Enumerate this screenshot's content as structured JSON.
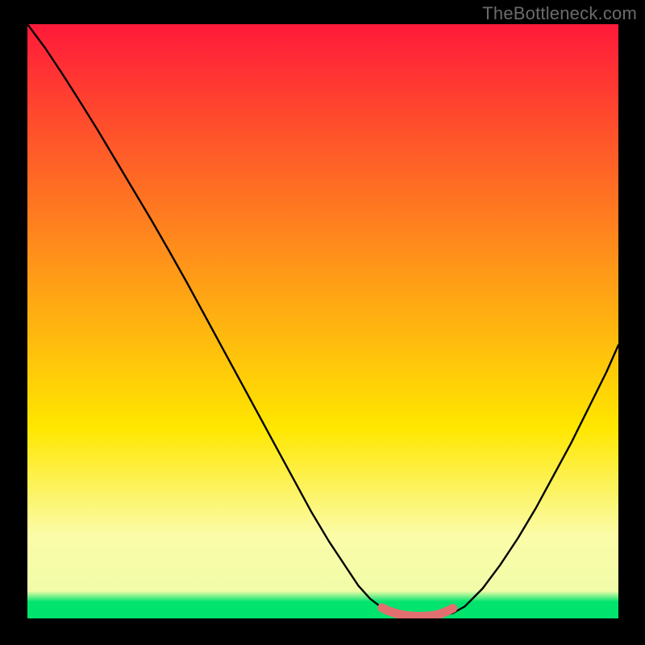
{
  "watermark": "TheBottleneck.com",
  "chart_data": {
    "type": "line",
    "title": "",
    "xlabel": "",
    "ylabel": "",
    "xlim": [
      0,
      100
    ],
    "ylim": [
      0,
      100
    ],
    "grid": false,
    "background_gradient": {
      "stops": [
        {
          "offset": 0.0,
          "color": "#ff1a3a"
        },
        {
          "offset": 0.44,
          "color": "#ffa016"
        },
        {
          "offset": 0.68,
          "color": "#ffe700"
        },
        {
          "offset": 0.86,
          "color": "#fbfca8"
        },
        {
          "offset": 0.954,
          "color": "#f1fca8"
        },
        {
          "offset": 0.972,
          "color": "#00e46e"
        },
        {
          "offset": 1.0,
          "color": "#00e46e"
        }
      ]
    },
    "series": [
      {
        "name": "bottleneck-curve",
        "color": "#000000",
        "x": [
          0.0,
          3.0,
          6.0,
          9.0,
          12.0,
          15.0,
          18.0,
          21.0,
          24.0,
          27.0,
          30.0,
          33.0,
          36.0,
          39.0,
          42.0,
          45.0,
          48.0,
          51.0,
          54.0,
          56.0,
          58.0,
          60.0,
          62.0,
          64.0,
          66.0,
          68.0,
          70.0,
          72.0,
          74.0,
          77.0,
          80.0,
          83.0,
          86.0,
          89.0,
          92.0,
          95.0,
          98.0,
          100.0
        ],
        "y": [
          100.0,
          96.0,
          91.5,
          86.8,
          82.0,
          77.0,
          72.0,
          67.0,
          61.8,
          56.5,
          51.0,
          45.5,
          40.0,
          34.5,
          29.0,
          23.5,
          18.0,
          13.0,
          8.5,
          5.5,
          3.3,
          1.8,
          0.9,
          0.4,
          0.3,
          0.3,
          0.4,
          0.9,
          2.0,
          5.0,
          9.0,
          13.5,
          18.5,
          24.0,
          29.5,
          35.5,
          41.5,
          46.0
        ]
      },
      {
        "name": "highlight-trough",
        "color": "#e26f6f",
        "x": [
          60.0,
          61.0,
          62.0,
          63.0,
          64.0,
          65.0,
          66.0,
          67.0,
          68.0,
          69.0,
          70.0,
          71.0,
          72.0
        ],
        "y": [
          1.8,
          1.3,
          0.95,
          0.7,
          0.5,
          0.4,
          0.35,
          0.35,
          0.4,
          0.55,
          0.8,
          1.2,
          1.7
        ]
      }
    ]
  }
}
